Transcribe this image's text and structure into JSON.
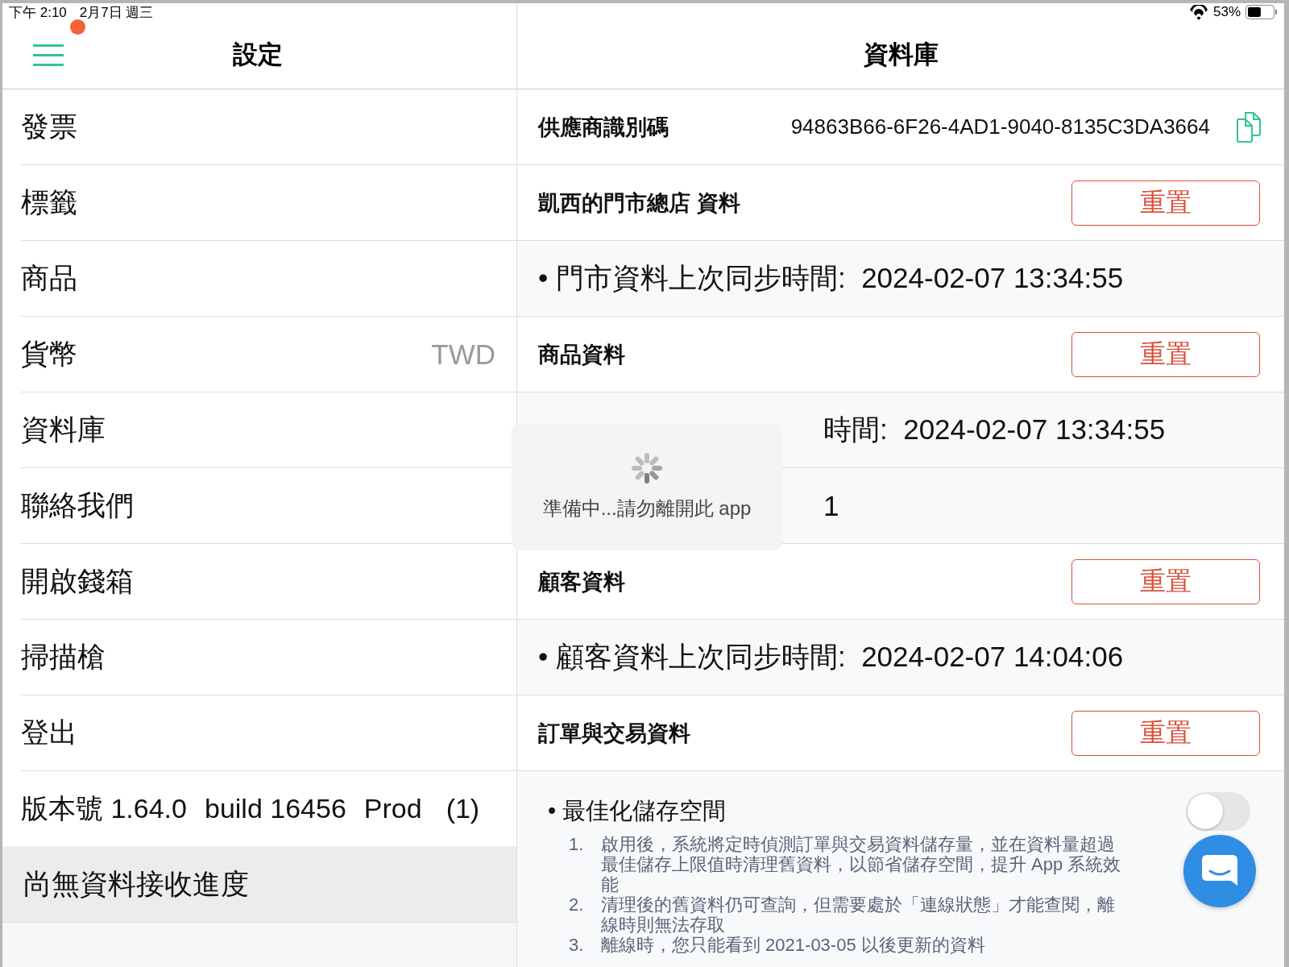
{
  "status_bar": {
    "time": "下午 2:10",
    "date": "2月7日 週三",
    "battery": "53%",
    "recording": true
  },
  "sidebar": {
    "title": "設定",
    "items": [
      {
        "label": "發票",
        "selected": false
      },
      {
        "label": "標籤",
        "selected": false
      },
      {
        "label": "商品",
        "selected": false
      },
      {
        "label": "貨幣",
        "value": "TWD",
        "selected": false
      },
      {
        "label": "資料庫",
        "selected": false
      },
      {
        "label": "聯絡我們",
        "selected": false
      },
      {
        "label": "開啟錢箱",
        "selected": false
      },
      {
        "label": "掃描槍",
        "selected": false
      },
      {
        "label": "登出",
        "selected": false
      }
    ],
    "version": [
      "版本號 1.64.0",
      "build 16456",
      "Prod",
      "(1)"
    ],
    "sync_status": "尚無資料接收進度"
  },
  "detail": {
    "title": "資料庫",
    "vendor_id": {
      "label": "供應商識別碼",
      "value": "94863B66-6F26-4AD1-9040-8135C3DA3664"
    },
    "rows": [
      {
        "kind": "reset",
        "label": "凱西的門市總店 資料",
        "button": "重置"
      },
      {
        "kind": "info",
        "text": "• 門市資料上次同步時間:  2024-02-07 13:34:55"
      },
      {
        "kind": "reset",
        "label": "商品資料",
        "button": "重置"
      },
      {
        "kind": "partial",
        "text": "時間:  2024-02-07 13:34:55"
      },
      {
        "kind": "partial",
        "text": "1"
      },
      {
        "kind": "reset",
        "label": "顧客資料",
        "button": "重置"
      },
      {
        "kind": "info",
        "text": "• 顧客資料上次同步時間:  2024-02-07 14:04:06"
      },
      {
        "kind": "reset",
        "label": "訂單與交易資料",
        "button": "重置"
      }
    ],
    "optimize": {
      "label": "• 最佳化儲存空間",
      "on": false,
      "notes": [
        {
          "number": "1.",
          "text": "啟用後，系統將定時偵測訂單與交易資料儲存量，並在資料量超過最佳儲存上限值時清理舊資料，以節省儲存空間，提升 App 系統效能"
        },
        {
          "number": "2.",
          "text": "清理後的舊資料仍可查詢，但需要處於「連線狀態」才能查閱，離線時則無法存取"
        },
        {
          "number": "3.",
          "text": "離線時，您只能看到 2021-03-05 以後更新的資料"
        }
      ]
    }
  },
  "loading": {
    "text": "準備中...請勿離開此 app"
  }
}
